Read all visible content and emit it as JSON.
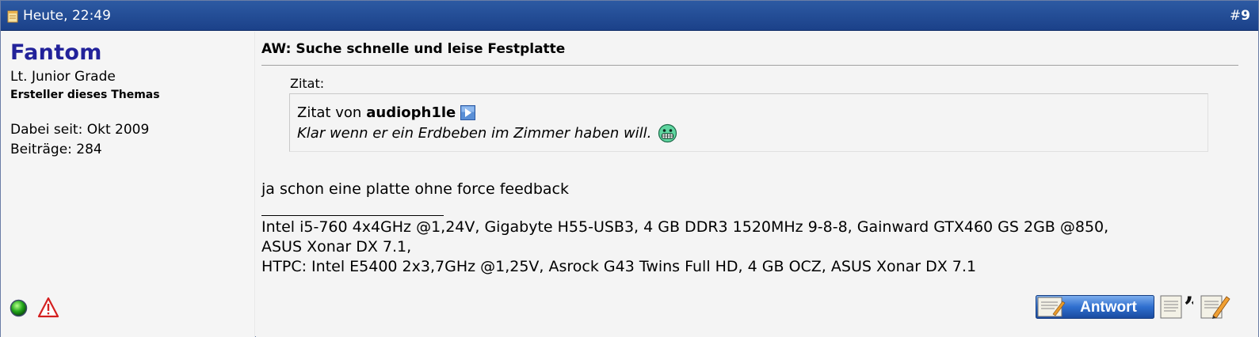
{
  "header": {
    "date": "Heute, 22:49",
    "post_hash": "#",
    "post_number": "9",
    "bg_color": "#1b4189"
  },
  "user": {
    "name": "Fantom",
    "name_color": "#22229a",
    "rank": "Lt. Junior Grade",
    "threadstarter": "Ersteller dieses Themas",
    "joined": "Dabei seit: Okt 2009",
    "posts": "Beiträge: 284",
    "status_icon": "online-status-icon",
    "report_icon": "report-warning-icon"
  },
  "post": {
    "title": "AW: Suche schnelle und leise Festplatte",
    "quote_label": "Zitat:",
    "quote_by_prefix": "Zitat von",
    "quote_author": "audioph1le",
    "quote_text": "Klar wenn er ein Erdbeben im Zimmer haben will.",
    "message": "ja schon eine platte ohne force feedback",
    "signature_line1": "Intel i5-760 4x4GHz @1,24V, Gigabyte H55-USB3, 4 GB DDR3 1520MHz 9-8-8, Gainward GTX460 GS 2GB @850,",
    "signature_line2": "ASUS Xonar DX 7.1,",
    "signature_line3": "HTPC: Intel E5400 2x3,7GHz @1,25V, Asrock G43 Twins Full HD, 4 GB OCZ, ASUS Xonar DX 7.1"
  },
  "buttons": {
    "reply_label": "Antwort",
    "quote_icon": "quote-reply-icon",
    "edit_icon": "edit-post-icon"
  }
}
